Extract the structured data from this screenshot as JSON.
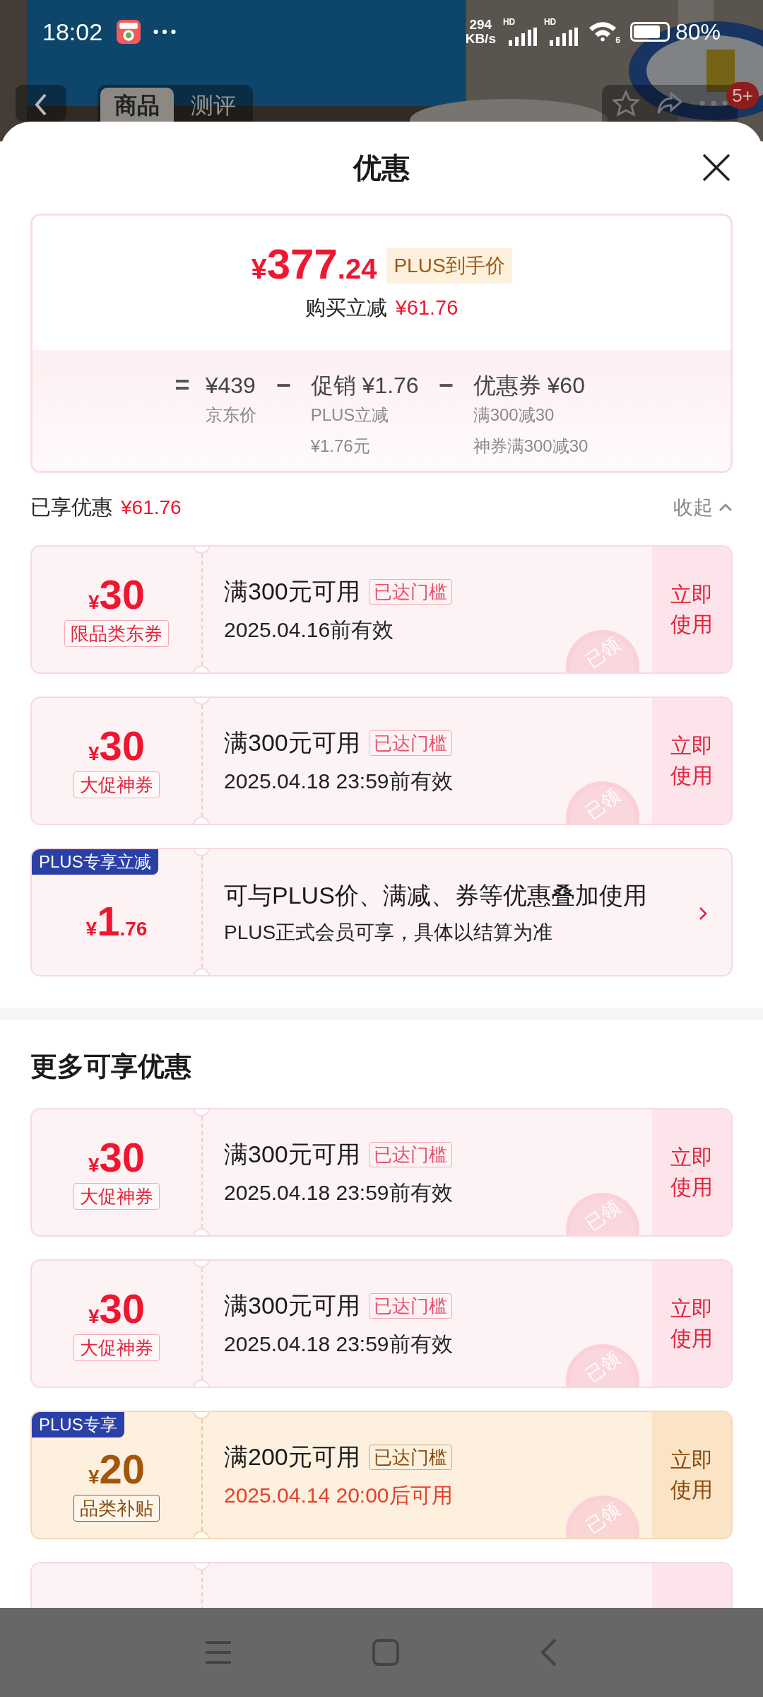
{
  "status_bar": {
    "time": "18:02",
    "speed_value": "294",
    "speed_unit": "KB/s",
    "signal_labels": [
      "HD",
      "HD"
    ],
    "wifi_label": "6",
    "battery": "80%"
  },
  "header": {
    "tabs": [
      {
        "label": "商品",
        "selected": true
      },
      {
        "label": "测评",
        "selected": false
      }
    ],
    "badge": "5+"
  },
  "sheet": {
    "title": "优惠"
  },
  "summary": {
    "currency": "¥",
    "price_int": "377",
    "price_dec": ".24",
    "price_tag": "PLUS到手价",
    "reduction_label": "购买立减",
    "reduction_value": "¥61.76",
    "breakdown": [
      {
        "op": "=",
        "amount": "¥439",
        "notes": [
          "京东价"
        ]
      },
      {
        "op": "−",
        "amount": "促销 ¥1.76",
        "notes": [
          "PLUS立减",
          "¥1.76元"
        ]
      },
      {
        "op": "−",
        "amount": "优惠券 ¥60",
        "notes": [
          "满300减30",
          "神券满300减30"
        ]
      }
    ]
  },
  "enjoyed": {
    "label": "已享优惠",
    "value": "¥61.76",
    "toggle": "收起"
  },
  "coupons": [
    {
      "kind": "coupon",
      "currency": "¥",
      "amount": "30",
      "tag": "限品类东券",
      "condition": "满300元可用",
      "badge": "已达门槛",
      "validity": "2025.04.16前有效",
      "validity_alert": false,
      "action": "立即使用",
      "stamp": "已领"
    },
    {
      "kind": "coupon",
      "currency": "¥",
      "amount": "30",
      "tag": "大促神券",
      "condition": "满300元可用",
      "badge": "已达门槛",
      "validity": "2025.04.18 23:59前有效",
      "validity_alert": false,
      "action": "立即使用",
      "stamp": "已领"
    },
    {
      "kind": "plus_benefit",
      "corner": "PLUS专享立减",
      "currency": "¥",
      "amount": "1",
      "amount_dec": ".76",
      "line1": "可与PLUS价、满减、券等优惠叠加使用",
      "line2": "PLUS正式会员可享，具体以结算为准"
    }
  ],
  "more": {
    "title": "更多可享优惠",
    "coupons": [
      {
        "kind": "coupon",
        "currency": "¥",
        "amount": "30",
        "tag": "大促神券",
        "condition": "满300元可用",
        "badge": "已达门槛",
        "validity": "2025.04.18 23:59前有效",
        "validity_alert": false,
        "action": "立即使用",
        "stamp": "已领"
      },
      {
        "kind": "coupon",
        "currency": "¥",
        "amount": "30",
        "tag": "大促神券",
        "condition": "满300元可用",
        "badge": "已达门槛",
        "validity": "2025.04.18 23:59前有效",
        "validity_alert": false,
        "action": "立即使用",
        "stamp": "已领"
      },
      {
        "kind": "plus_coupon",
        "corner": "PLUS专享",
        "currency": "¥",
        "amount": "20",
        "tag": "品类补贴",
        "condition": "满200元可用",
        "badge": "已达门槛",
        "validity": "2025.04.14 20:00后可用",
        "validity_alert": true,
        "action": "立即使用",
        "stamp": "已领"
      },
      {
        "kind": "partial"
      }
    ]
  }
}
